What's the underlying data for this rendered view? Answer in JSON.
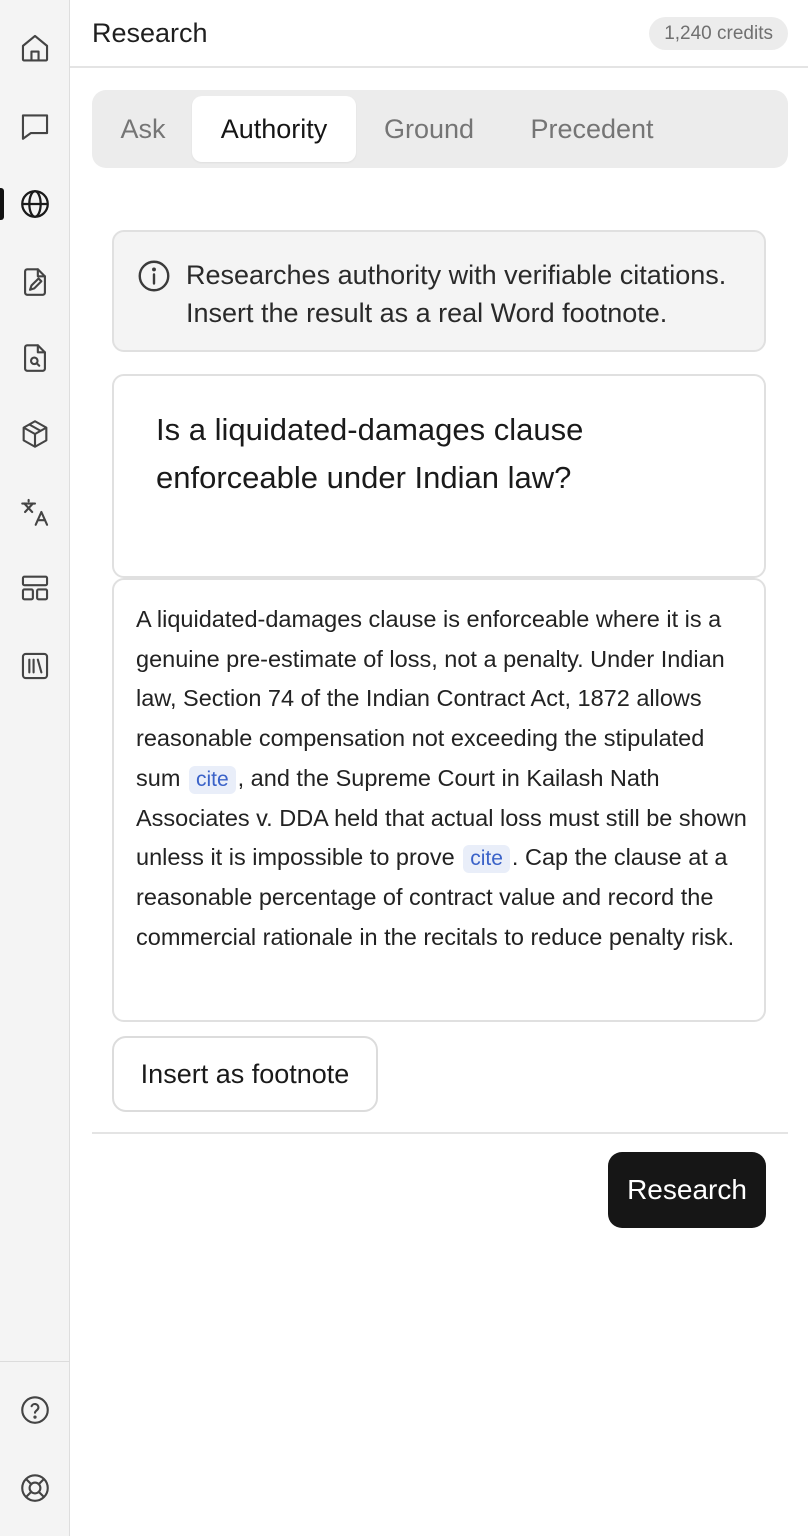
{
  "header": {
    "title": "Research",
    "credits": "1,240 credits"
  },
  "sidebar": {
    "items": [
      {
        "name": "home",
        "icon": "home-icon"
      },
      {
        "name": "chat",
        "icon": "chat-icon"
      },
      {
        "name": "research",
        "icon": "globe-icon",
        "active": true
      },
      {
        "name": "draft",
        "icon": "file-pen-icon"
      },
      {
        "name": "review",
        "icon": "file-search-icon"
      },
      {
        "name": "extract",
        "icon": "box-icon"
      },
      {
        "name": "translate",
        "icon": "translate-icon"
      },
      {
        "name": "templates",
        "icon": "layout-icon"
      },
      {
        "name": "library",
        "icon": "library-icon"
      }
    ],
    "bottom_items": [
      {
        "name": "help",
        "icon": "help-circle-icon"
      },
      {
        "name": "support",
        "icon": "life-buoy-icon"
      }
    ]
  },
  "tabs": [
    {
      "label": "Ask"
    },
    {
      "label": "Authority",
      "active": true
    },
    {
      "label": "Ground"
    },
    {
      "label": "Precedent"
    }
  ],
  "info": {
    "text": "Researches authority with verifiable citations. Insert the result as a real Word footnote."
  },
  "query": {
    "text": "Is a liquidated-damages clause enforceable under Indian law?"
  },
  "answer": {
    "part1": "A liquidated-damages clause is enforceable where it is a genuine pre-estimate of loss, not a penalty. Under Indian law, Section 74 of the Indian Contract Act, 1872 allows reasonable compensation not exceeding the stipulated sum ",
    "cite_label": "cite",
    "part2": ", and the Supreme Court in Kailash Nath Associates v. DDA held that actual loss must still be shown unless it is impossible to prove ",
    "part3": ". Cap the clause at a reasonable percentage of contract value and record the commercial rationale in the recitals to reduce penalty risk."
  },
  "actions": {
    "insert_footnote": "Insert as footnote",
    "research": "Research"
  },
  "colors": {
    "primary_button": "#161616",
    "cite_bg": "#e9eef9",
    "cite_text": "#3a62c8",
    "rail_bg": "#f4f4f4"
  }
}
